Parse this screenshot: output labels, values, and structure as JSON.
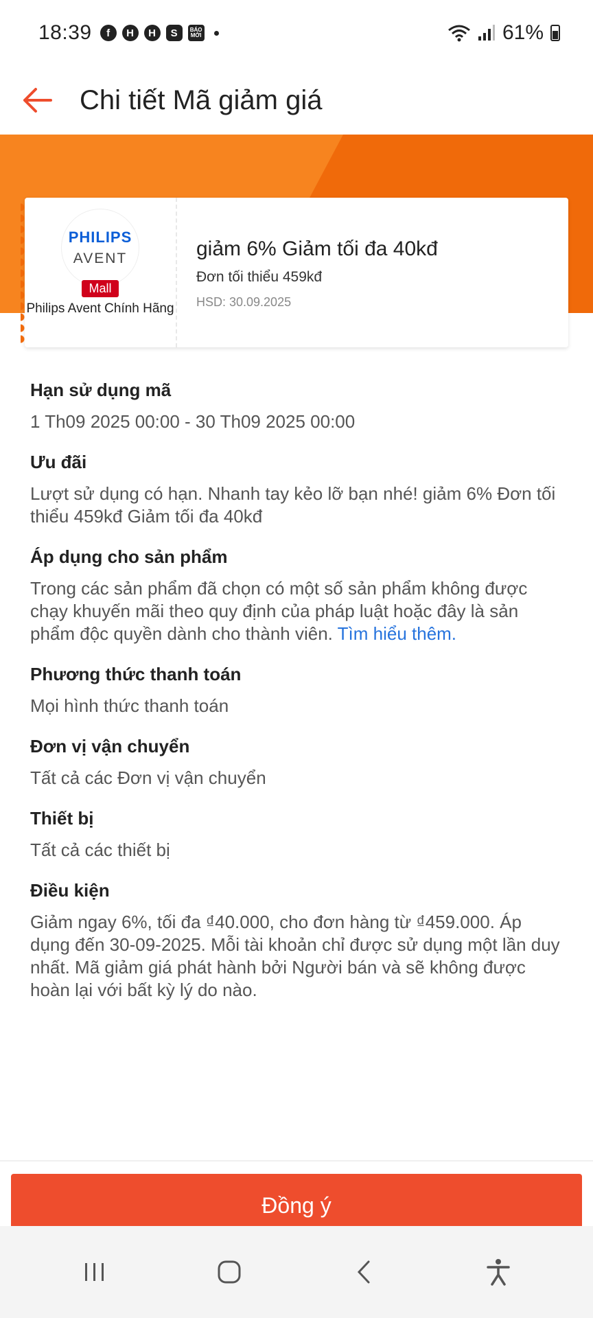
{
  "status_bar": {
    "time": "18:39",
    "apps": [
      "f",
      "H",
      "H",
      "S",
      "BÁO MỚI"
    ],
    "battery": "61%"
  },
  "header": {
    "title": "Chi tiết Mã giảm giá"
  },
  "voucher": {
    "brand_line1": "PHILIPS",
    "brand_line2": "AVENT",
    "badge": "Mall",
    "shop_name": "Philips Avent Chính Hãng",
    "title": "giảm 6% Giảm tối đa 40kđ",
    "min_order": "Đơn tối thiểu 459kđ",
    "expiry": "HSD: 30.09.2025"
  },
  "sections": {
    "validity": {
      "title": "Hạn sử dụng mã",
      "body": "1 Th09 2025 00:00 - 30 Th09 2025 00:00"
    },
    "offer": {
      "title": "Ưu đãi",
      "body": "Lượt sử dụng có hạn. Nhanh tay kẻo lỡ bạn nhé! giảm 6% Đơn tối thiểu 459kđ Giảm tối đa 40kđ"
    },
    "products": {
      "title": "Áp dụng cho sản phẩm",
      "body": "Trong các sản phẩm đã chọn có một số sản phẩm không được chạy khuyến mãi theo quy định của pháp luật hoặc đây là sản phẩm độc quyền dành cho thành viên. ",
      "link": "Tìm hiểu thêm."
    },
    "payment": {
      "title": "Phương thức thanh toán",
      "body": "Mọi hình thức thanh toán"
    },
    "shipping": {
      "title": "Đơn vị vận chuyển",
      "body": "Tất cả các Đơn vị vận chuyển"
    },
    "device": {
      "title": "Thiết bị",
      "body": "Tất cả các thiết bị"
    },
    "conditions": {
      "title": "Điều kiện",
      "body": "Giảm ngay 6%, tối đa ₫40.000, cho đơn hàng từ ₫459.000. Áp dụng đến 30-09-2025. Mỗi tài khoản chỉ được sử dụng một lần duy nhất. Mã giảm giá phát hành bởi Người bán và sẽ không được hoàn lại với bất kỳ lý do nào."
    }
  },
  "footer": {
    "agree_label": "Đồng ý"
  },
  "colors": {
    "brand_orange": "#ee4d2d",
    "banner_dark": "#f06a0a",
    "banner_light": "#f7841f",
    "link_blue": "#2673dd"
  },
  "icons": {
    "back": "arrow-left-icon",
    "nav_recents": "recents-icon",
    "nav_home": "home-icon",
    "nav_back": "back-icon",
    "nav_accessibility": "accessibility-icon"
  }
}
